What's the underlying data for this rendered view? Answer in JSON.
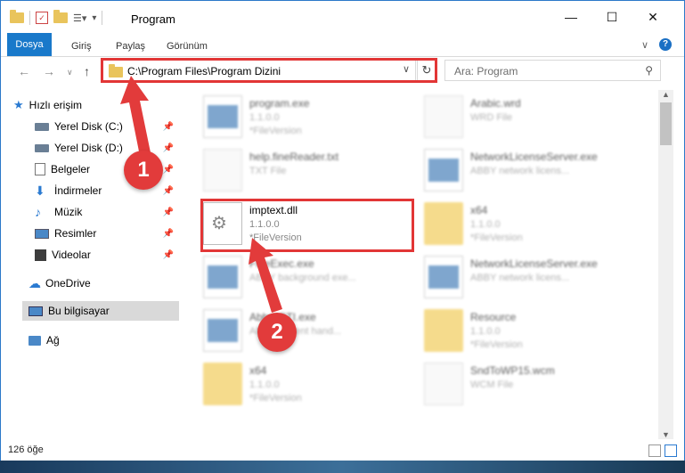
{
  "window": {
    "title": "Program"
  },
  "ribbon": {
    "tabs": [
      "Dosya",
      "Giriş",
      "Paylaş",
      "Görünüm"
    ],
    "help": "?"
  },
  "nav": {
    "address": "C:\\Program Files\\Program Dizini",
    "search_placeholder": "Ara: Program"
  },
  "sidebar": {
    "quick_access": "Hızlı erişim",
    "items": [
      {
        "label": "Yerel Disk (C:)",
        "icon": "drive-icon"
      },
      {
        "label": "Yerel Disk (D:)",
        "icon": "drive-icon"
      },
      {
        "label": "Belgeler",
        "icon": "documents-icon"
      },
      {
        "label": "İndirmeler",
        "icon": "download-icon"
      },
      {
        "label": "Müzik",
        "icon": "music-icon"
      },
      {
        "label": "Resimler",
        "icon": "pictures-icon"
      },
      {
        "label": "Videolar",
        "icon": "video-icon"
      }
    ],
    "onedrive": "OneDrive",
    "this_pc": "Bu bilgisayar",
    "network": "Ağ"
  },
  "files": {
    "left": [
      {
        "name": "program.exe",
        "sub1": "1.1.0.0",
        "sub2": "*FileVersion",
        "type": "exe"
      },
      {
        "name": "help.fineReader.txt",
        "sub1": "TXT File",
        "sub2": "",
        "type": "doc"
      },
      {
        "name": "imptext.dll",
        "sub1": "1.1.0.0",
        "sub2": "*FileVersion",
        "type": "dll"
      },
      {
        "name": "FineExec.exe",
        "sub1": "ABBY background exe...",
        "sub2": "",
        "type": "exe"
      },
      {
        "name": "AbbyySTI.exe",
        "sub1": "ABBYY event hand...",
        "sub2": "",
        "type": "exe"
      },
      {
        "name": "x64",
        "sub1": "1.1.0.0",
        "sub2": "*FileVersion",
        "type": "folder"
      }
    ],
    "right": [
      {
        "name": "Arabic.wrd",
        "sub1": "WRD File",
        "sub2": "",
        "type": "doc"
      },
      {
        "name": "NetworkLicenseServer.exe",
        "sub1": "ABBY network licens...",
        "sub2": "",
        "type": "exe"
      },
      {
        "name": "x64",
        "sub1": "1.1.0.0",
        "sub2": "*FileVersion",
        "type": "folder"
      },
      {
        "name": "NetworkLicenseServer.exe",
        "sub1": "ABBY network licens...",
        "sub2": "",
        "type": "exe"
      },
      {
        "name": "Resource",
        "sub1": "1.1.0.0",
        "sub2": "*FileVersion",
        "type": "folder"
      },
      {
        "name": "SndToWP15.wcm",
        "sub1": "WCM File",
        "sub2": "",
        "type": "doc"
      }
    ]
  },
  "status": {
    "count": "126 öğe"
  },
  "callouts": {
    "one": "1",
    "two": "2"
  },
  "colors": {
    "accent": "#1979ca",
    "highlight": "#e23636"
  }
}
